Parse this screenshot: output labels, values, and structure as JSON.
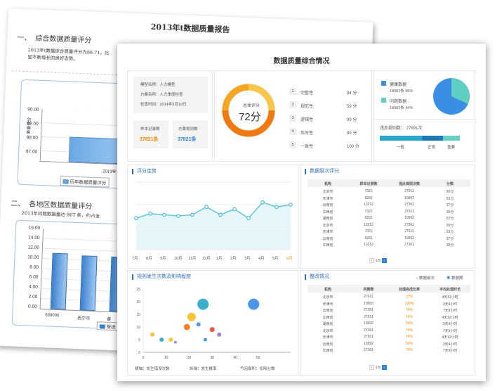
{
  "back_page": {
    "title": "2013年t数据质量报告",
    "section1": {
      "num": "一、",
      "heading": "综合数据质量评分",
      "text1": "2013年t数据综合质量评分为88.71，比",
      "text2": "呈不断增长的良好态势。"
    },
    "chart1": {
      "yticks": [
        "90.00",
        "89.00",
        "88.00",
        "87.00"
      ],
      "ylabel": "质量评分",
      "xtick": "2013年",
      "legend": "历年数据质量评分"
    },
    "section2": {
      "num": "二、",
      "heading": "各地区数据质量评分",
      "text": "2013年问题数据量达 86T 条，约占全"
    },
    "chart2": {
      "yticks": [
        "16.00",
        "14.00",
        "12.00",
        "10.00",
        "8.00",
        "6.00",
        "4.00",
        "2.00",
        "0.00"
      ],
      "xticks": [
        "630000",
        "西宁市",
        "黄"
      ],
      "legend": "报送"
    }
  },
  "front_page": {
    "title": "数据质量综合情况",
    "model_info": {
      "model_name": "模型名称：人力模型",
      "plan_name": "方案名称：人力季度检查",
      "check_time": "检查时间：2014年9月19日"
    },
    "sample_count": {
      "label": "样本记录数",
      "value": "37821条"
    },
    "plan_rules": {
      "label": "方案规则数",
      "value": "37821条"
    },
    "overall": {
      "label": "总体评分",
      "value": "72分"
    },
    "scores": [
      {
        "rank": "1",
        "name": "完整性",
        "score": "84 分"
      },
      {
        "rank": "2",
        "name": "规范性",
        "score": "59 分"
      },
      {
        "rank": "3",
        "name": "逻辑性",
        "score": "99 分"
      },
      {
        "rank": "4",
        "name": "及时性",
        "score": "89 分"
      },
      {
        "rank": "5",
        "name": "一致性",
        "score": "100 分"
      }
    ],
    "pie_legend": [
      {
        "name": "健康数据",
        "detail": "18982条  56%",
        "color": "#3a8ee6"
      },
      {
        "name": "问题数据",
        "detail": "18982条  44%",
        "color": "#5fcfc4"
      }
    ],
    "violations": {
      "label": "违反规则数：  27891次",
      "levels": [
        "一般",
        "正常",
        "重要"
      ]
    },
    "trend": {
      "title": "评分走势",
      "months": [
        "7月",
        "8月",
        "9月",
        "10月",
        "11月",
        "12月",
        "1月",
        "2月",
        "3月",
        "4月",
        "5月",
        "6月"
      ]
    },
    "level_table": {
      "title": "数据级次评分",
      "headers": [
        "机构",
        "样本记录数",
        "违反规则次数",
        "分数"
      ],
      "rows": [
        [
          "北京市",
          "7321",
          "27911",
          "90分"
        ],
        [
          "天津市",
          "6931",
          "19992",
          "53分"
        ],
        [
          "云南省",
          "13212",
          "27361",
          "27分"
        ],
        [
          "江西省",
          "7321",
          "27911",
          "30分"
        ],
        [
          "湖南省",
          "6931",
          "19992",
          "52分"
        ],
        [
          "北京市",
          "13212",
          "27361",
          "30分"
        ],
        [
          "天津市",
          "7321",
          "27911",
          "53分"
        ],
        [
          "云南省",
          "6931",
          "19992",
          "27分"
        ],
        [
          "江西省",
          "13212",
          "27361",
          "30分"
        ]
      ],
      "page": "1/5"
    },
    "bubble": {
      "title": "规则发生次数及影响程度",
      "yticks": [
        "25",
        "20",
        "15",
        "10",
        "5",
        "0"
      ],
      "xticks": [
        "0",
        "10",
        "20",
        "30",
        "40",
        "50"
      ],
      "caption_x": "横轴：发生错误次数",
      "caption_y": "纵轴：发生概率",
      "caption_size": "气泡面积：扣除分数"
    },
    "rectify": {
      "title": "整改情况",
      "toggle": [
        "数据级次",
        "数据期"
      ],
      "headers": [
        "机构",
        "问题数",
        "处理完成比率",
        "平均处理时长"
      ],
      "rows": [
        [
          "北京市",
          "27911",
          "37%",
          "4天12小时"
        ],
        [
          "天津市",
          "19992",
          "100%",
          "3天4小时"
        ],
        [
          "云南省",
          "27361",
          "74%",
          "7天9小时"
        ],
        [
          "江西省",
          "27911",
          "74%",
          "4天12小时"
        ],
        [
          "湖南省",
          "19992",
          "56%",
          "3天4小时"
        ],
        [
          "北京市",
          "27361",
          "74%",
          "7天9小时"
        ],
        [
          "天津市",
          "27911",
          "74%",
          "4天12小时"
        ],
        [
          "云南省",
          "19992",
          "56%",
          "3天4小时"
        ],
        [
          "江西省",
          "27361",
          "74%",
          "7天9小时"
        ]
      ],
      "page": "1/5"
    }
  },
  "chart_data": [
    {
      "type": "line",
      "title": "评分走势",
      "x": [
        "7月",
        "8月",
        "9月",
        "10月",
        "11月",
        "12月",
        "1月",
        "2月",
        "3月",
        "4月",
        "5月",
        "6月"
      ],
      "values": [
        28,
        32,
        31,
        30,
        31,
        38,
        31,
        36,
        28,
        42,
        38,
        40
      ]
    },
    {
      "type": "scatter",
      "title": "规则发生次数及影响程度",
      "points": [
        [
          4,
          7
        ],
        [
          8,
          5
        ],
        [
          12,
          5
        ],
        [
          14,
          4
        ],
        [
          19,
          10
        ],
        [
          21,
          14
        ],
        [
          24,
          11
        ],
        [
          26,
          19
        ],
        [
          27,
          5
        ],
        [
          30,
          9
        ],
        [
          33,
          7
        ],
        [
          48,
          19
        ]
      ]
    }
  ]
}
